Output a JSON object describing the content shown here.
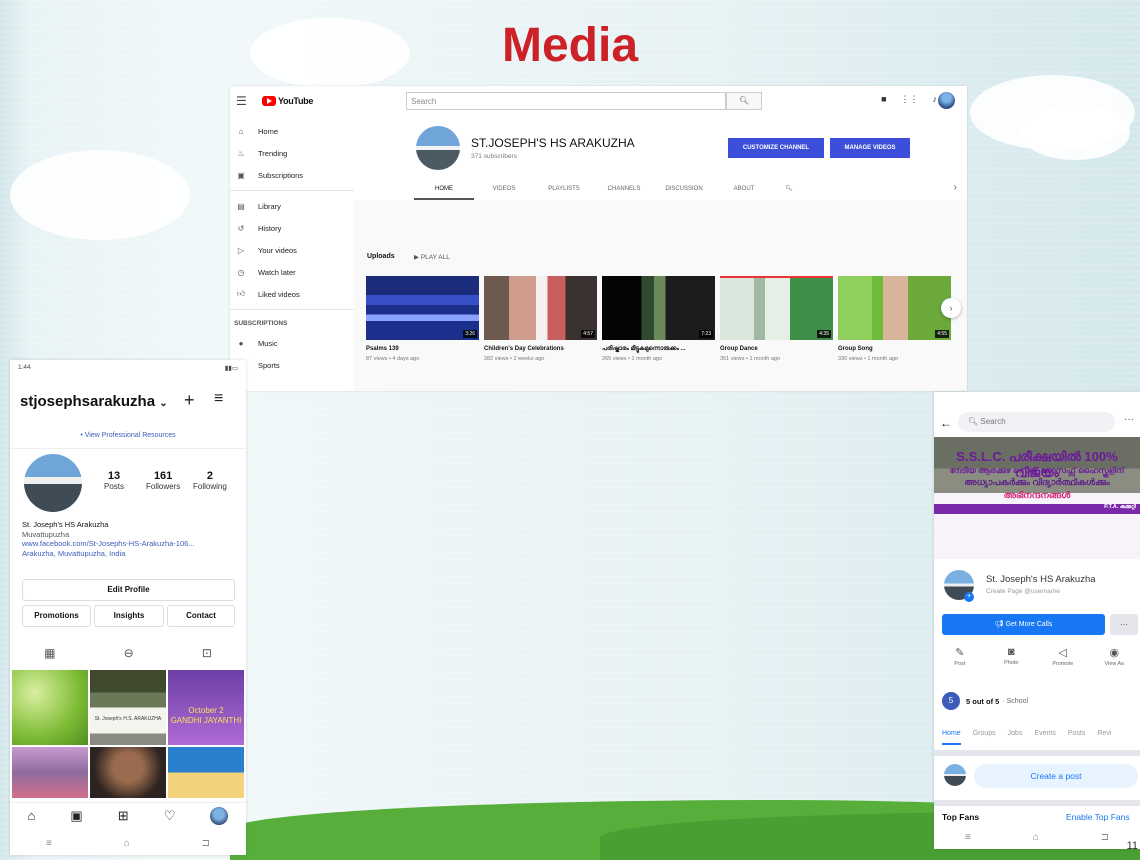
{
  "slide": {
    "title": "Media",
    "page_number": "11"
  },
  "youtube": {
    "logo": "YouTube",
    "search_placeholder": "Search",
    "search_icon": "search-icon",
    "sidebar": [
      {
        "label": "Home",
        "icon": "home-icon"
      },
      {
        "label": "Trending",
        "icon": "trending-icon"
      },
      {
        "label": "Subscriptions",
        "icon": "subscriptions-icon"
      },
      {
        "label": "Library",
        "icon": "library-icon"
      },
      {
        "label": "History",
        "icon": "history-icon"
      },
      {
        "label": "Your videos",
        "icon": "your-videos-icon"
      },
      {
        "label": "Watch later",
        "icon": "watch-later-icon"
      },
      {
        "label": "Liked videos",
        "icon": "liked-videos-icon"
      }
    ],
    "subscriptions_heading": "SUBSCRIPTIONS",
    "subscriptions": [
      {
        "label": "Music",
        "icon": "music-icon"
      },
      {
        "label": "Sports",
        "icon": "sports-icon"
      }
    ],
    "channel": {
      "name": "ST.JOSEPH'S HS ARAKUZHA",
      "subscribers": "371 subscribers",
      "customize_button": "CUSTOMIZE CHANNEL",
      "manage_button": "MANAGE VIDEOS"
    },
    "tabs": [
      "HOME",
      "VIDEOS",
      "PLAYLISTS",
      "CHANNELS",
      "DISCUSSION",
      "ABOUT"
    ],
    "uploads_label": "Uploads",
    "play_all_label": "PLAY ALL",
    "videos": [
      {
        "title": "Psalms 139",
        "meta": "87 views • 4 days ago",
        "duration": "3:26"
      },
      {
        "title": "Children's Day Celebrations",
        "meta": "282 views • 2 weeks ago",
        "duration": "4:57"
      },
      {
        "title": "പരിഷ്കാരം മീട്ടുകമുന്നൊരുക്കം ...",
        "meta": "265 views • 1 month ago",
        "duration": "7:23"
      },
      {
        "title": "Group Dance",
        "meta": "351 views • 1 month ago",
        "duration": "4:35"
      },
      {
        "title": "Group Song",
        "meta": "330 views • 1 month ago",
        "duration": "4:55"
      }
    ]
  },
  "instagram": {
    "status_time": "1:44",
    "username": "stjosephsarakuzha",
    "professional_link": "• View Professional Resources",
    "stats": [
      {
        "value": "13",
        "label": "Posts"
      },
      {
        "value": "161",
        "label": "Followers"
      },
      {
        "value": "2",
        "label": "Following"
      }
    ],
    "bio_name": "St. Joseph's HS Arakuzha",
    "bio_city": "Muvattupuzha",
    "bio_link": "www.facebook.com/St-Josephs-HS-Arakuzha-106...",
    "bio_location": "Arakuzha, Muvattupuzha, India",
    "edit_profile": "Edit Profile",
    "buttons": [
      "Promotions",
      "Insights",
      "Contact"
    ],
    "grid_texts": [
      "St. Joseph's H.S. ARAKUZHA",
      "October 2",
      "GANDHI JAYANTHI"
    ]
  },
  "facebook": {
    "search_placeholder": "Search",
    "banner_line1": "S.S.L.C. പരീക്ഷയിൽ 100% വിജയം",
    "banner_line2": "നേടിയ ആരക്കുഴ സെന്റ് ജോസഫ്സ് ഹൈസ്കൂളിന്",
    "banner_line3": "അധ്യാപകർക്കും വിദ്യാർത്ഥികൾക്കും",
    "banner_line4": "അഭിനന്ദനങ്ങൾ",
    "banner_footer": "P.T.A. കമ്മറ്റി",
    "page_name": "St. Joseph's HS Arakuzha",
    "page_sub": "Create Page @username",
    "cta": "Get More Calls",
    "actions": [
      {
        "label": "Post",
        "icon": "edit-icon"
      },
      {
        "label": "Photo",
        "icon": "camera-icon"
      },
      {
        "label": "Promote",
        "icon": "megaphone-icon"
      },
      {
        "label": "View As",
        "icon": "eye-icon"
      }
    ],
    "rating_badge": "5",
    "rating_text": "5 out of 5",
    "rating_category": "· School",
    "tabs": [
      "Home",
      "Groups",
      "Jobs",
      "Events",
      "Posts",
      "Revi"
    ],
    "create_post": "Create a post",
    "top_fans": "Top Fans",
    "enable_top_fans": "Enable Top Fans"
  }
}
